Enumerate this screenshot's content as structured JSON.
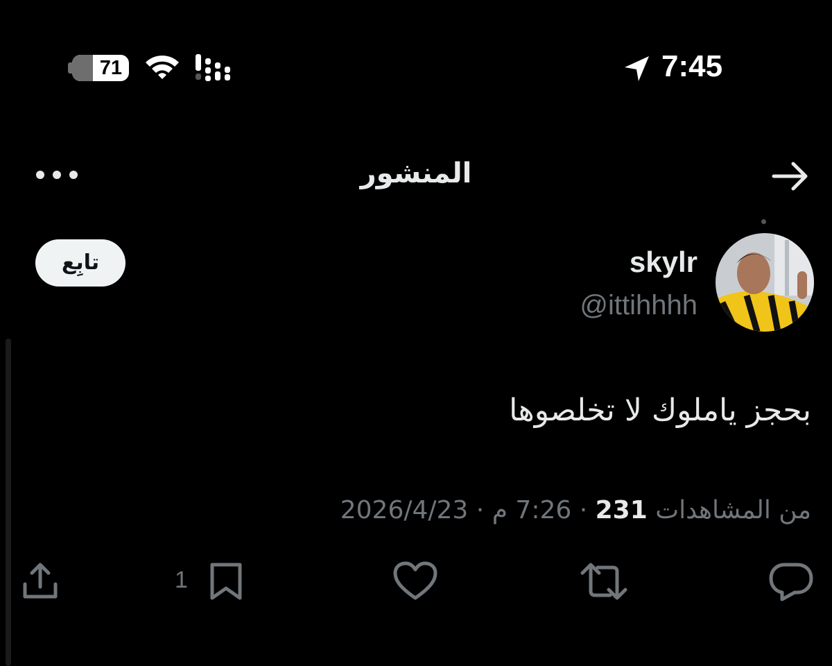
{
  "status_bar": {
    "battery_level": "71",
    "time": "7:45",
    "icons": [
      "battery-icon",
      "wifi-icon",
      "cellular-signal-icon",
      "location-arrow-icon"
    ]
  },
  "header": {
    "title": "المنشور",
    "back_icon": "arrow-right-icon",
    "more_icon": "more-horizontal-icon"
  },
  "author": {
    "display_name": "skylr",
    "handle": "@ittihhhh",
    "follow_label": "تابِع"
  },
  "post": {
    "text": "بحجز ياملوك لا تخلصوها"
  },
  "meta": {
    "date": "2026/4/23",
    "time": "7:26 م",
    "views_count": "231",
    "views_label": "من المشاهدات",
    "separator": " · "
  },
  "actions": {
    "reply_icon": "reply-bubble-icon",
    "repost_icon": "repost-icon",
    "like_icon": "heart-icon",
    "bookmark_icon": "bookmark-icon",
    "bookmark_count": "1",
    "share_icon": "share-icon"
  },
  "colors": {
    "background": "#000000",
    "primary_text": "#e7e9ea",
    "secondary_text": "#71767b",
    "follow_button_bg": "#eff3f4"
  }
}
